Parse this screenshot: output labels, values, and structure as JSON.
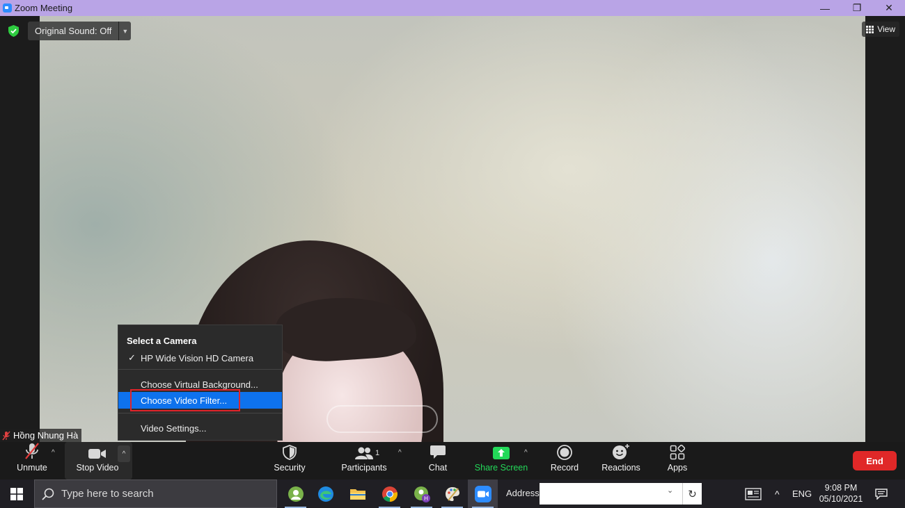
{
  "window": {
    "title": "Zoom Meeting",
    "minimize": "—",
    "maximize": "❐",
    "close": "✕"
  },
  "meeting": {
    "original_sound": "Original Sound: Off",
    "view_label": "View",
    "participant_name": "Hồng Nhung Hà"
  },
  "camera_menu": {
    "heading": "Select a Camera",
    "items": [
      {
        "label": "HP Wide Vision HD Camera",
        "checked": true
      },
      {
        "label": "Choose Virtual Background..."
      },
      {
        "label": "Choose Video Filter...",
        "highlighted": true
      },
      {
        "label": "Video Settings..."
      }
    ]
  },
  "toolbar": {
    "unmute": "Unmute",
    "stop_video": "Stop Video",
    "security": "Security",
    "participants": "Participants",
    "participants_count": "1",
    "chat": "Chat",
    "share_screen": "Share Screen",
    "record": "Record",
    "reactions": "Reactions",
    "apps": "Apps",
    "end": "End"
  },
  "taskbar": {
    "search_placeholder": "Type here to search",
    "address_label": "Address",
    "address_value": "",
    "language": "ENG",
    "time": "9:08 PM",
    "date": "05/10/2021"
  },
  "colors": {
    "title_bar": "#b9a4e6",
    "menu_highlight": "#0e72ed",
    "annotation_box": "#e1242a",
    "share_green": "#23d959",
    "end_red": "#e02828"
  }
}
